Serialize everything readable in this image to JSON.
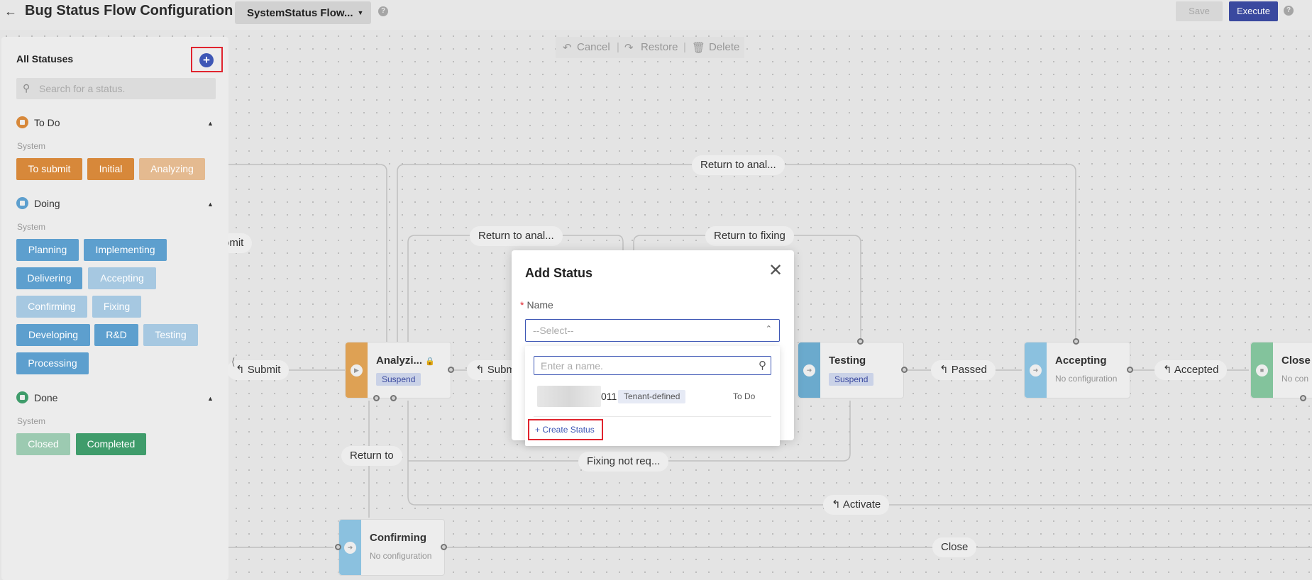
{
  "header": {
    "title": "Bug Status Flow Configuration",
    "flow_select": "SystemStatus Flow...",
    "save_label": "Save",
    "execute_label": "Execute"
  },
  "toolbar": {
    "cancel": "Cancel",
    "restore": "Restore",
    "delete": "Delete"
  },
  "nodes": {
    "analyzing": {
      "title": "Analyzi...",
      "tag": "Suspend"
    },
    "testing": {
      "title": "Testing",
      "tag": "Suspend"
    },
    "accepting": {
      "title": "Accepting",
      "sub": "No configuration"
    },
    "closed": {
      "title": "Close",
      "sub": "No con"
    },
    "confirming": {
      "title": "Confirming",
      "sub": "No configuration"
    }
  },
  "edges": {
    "return_to_anal_top": "Return to anal...",
    "return_to_anal_mid": "Return to anal...",
    "return_to_fixing": "Return to fixing",
    "submit_left": "Submit",
    "submit_mid": "Subm",
    "passed": "Passed",
    "accepted": "Accepted",
    "return_to": "Return to",
    "fixing_not_req": "Fixing not req...",
    "activate": "Activate",
    "close": "Close",
    "omit": "omit"
  },
  "panel": {
    "title": "All Statuses",
    "search_placeholder": "Search for a status.",
    "groups": [
      {
        "name": "To Do",
        "system_label": "System",
        "color": "#d7883a",
        "chips": [
          "To submit",
          "Initial",
          "Analyzing"
        ]
      },
      {
        "name": "Doing",
        "system_label": "System",
        "color": "#5d9fce",
        "chips": [
          "Planning",
          "Implementing",
          "Delivering",
          "Accepting",
          "Confirming",
          "Fixing",
          "Developing",
          "R&D",
          "Testing",
          "Processing"
        ]
      },
      {
        "name": "Done",
        "system_label": "System",
        "color": "#3f9c6b",
        "chips": [
          "Closed",
          "Completed"
        ]
      }
    ]
  },
  "modal": {
    "title": "Add Status",
    "name_label": "Name",
    "select_placeholder": "--Select--",
    "search_placeholder": "Enter a name.",
    "option": {
      "name_suffix": "011",
      "tag": "Tenant-defined",
      "type": "To Do"
    },
    "create_label": "Create Status"
  }
}
